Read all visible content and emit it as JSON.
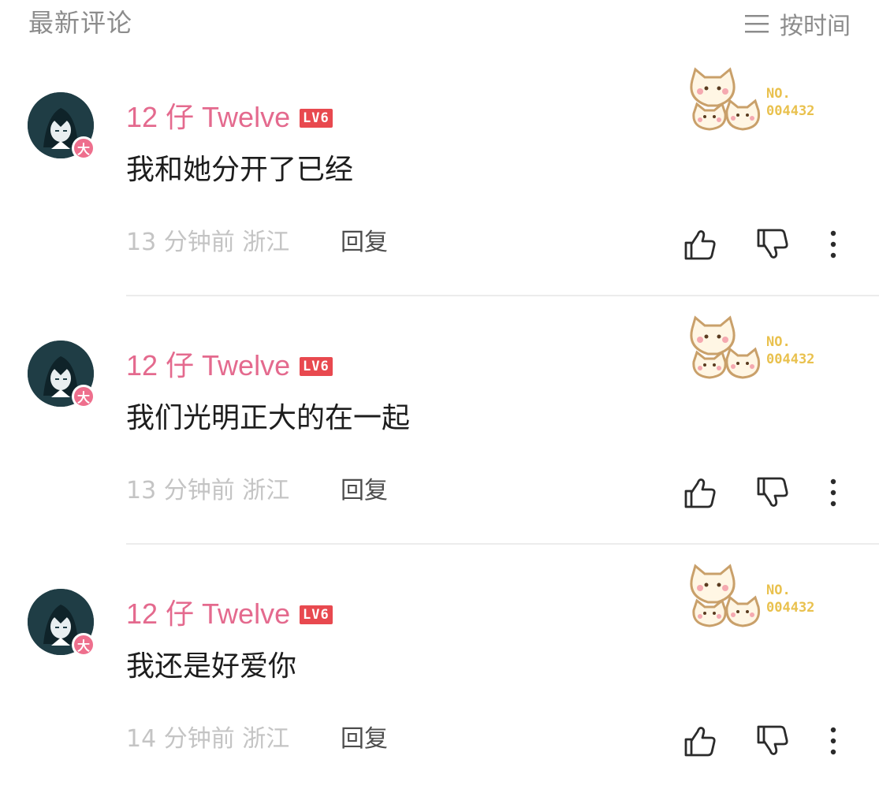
{
  "header": {
    "title": "最新评论",
    "sort_label": "按时间"
  },
  "comments": [
    {
      "username": "12 仔 Twelve",
      "level": "LV6",
      "badge": "大",
      "text": "我和她分开了已经",
      "time": "13 分钟前",
      "location": "浙江",
      "reply_label": "回复",
      "pendant_no_prefix": "NO.",
      "pendant_no": "004432"
    },
    {
      "username": "12 仔 Twelve",
      "level": "LV6",
      "badge": "大",
      "text": "我们光明正大的在一起",
      "time": "13 分钟前",
      "location": "浙江",
      "reply_label": "回复",
      "pendant_no_prefix": "NO.",
      "pendant_no": "004432"
    },
    {
      "username": "12 仔 Twelve",
      "level": "LV6",
      "badge": "大",
      "text": "我还是好爱你",
      "time": "14 分钟前",
      "location": "浙江",
      "reply_label": "回复",
      "pendant_no_prefix": "NO.",
      "pendant_no": "004432"
    }
  ],
  "icons": {
    "sort": "menu-lines-icon",
    "like": "thumbs-up-icon",
    "dislike": "thumbs-down-icon",
    "more": "more-vertical-icon"
  },
  "colors": {
    "username": "#e46a8e",
    "level_badge": "#e8494f",
    "member_badge": "#ee6f8d",
    "muted_text": "#c4c4c4"
  }
}
